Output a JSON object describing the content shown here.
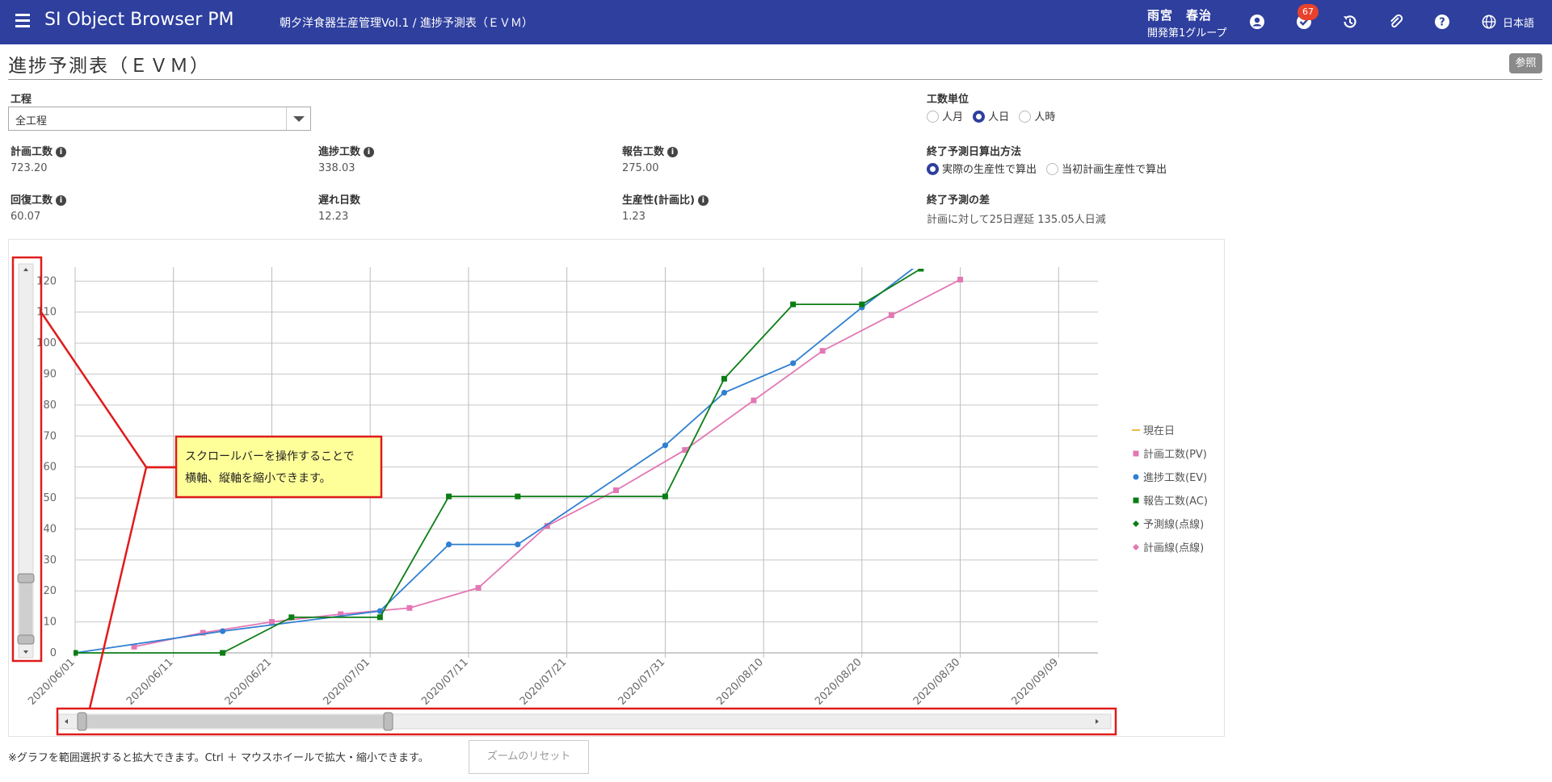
{
  "header": {
    "app_title": "SI Object Browser PM",
    "breadcrumb": "朝夕洋食器生産管理Vol.1 / 進捗予測表（ＥＶＭ）",
    "user_name": "雨宮　春治",
    "user_group": "開発第1グループ",
    "notification_count": "67",
    "language": "日本語",
    "icons": [
      "menu-icon",
      "account-icon",
      "task-check-icon",
      "history-icon",
      "attachment-icon",
      "help-icon",
      "globe-icon"
    ]
  },
  "page": {
    "title": "進捗予測表（ＥＶＭ）",
    "ref_button": "参照"
  },
  "form": {
    "process_label": "工程",
    "process_value": "全工程",
    "unit_label": "工数単位",
    "unit_options": [
      "人月",
      "人日",
      "人時"
    ],
    "unit_selected": "人日",
    "method_label": "終了予測日算出方法",
    "method_options": [
      "実際の生産性で算出",
      "当初計画生産性で算出"
    ],
    "method_selected": "実際の生産性で算出"
  },
  "stats": {
    "plan_label": "計画工数",
    "plan_value": "723.20",
    "progress_label": "進捗工数",
    "progress_value": "338.03",
    "report_label": "報告工数",
    "report_value": "275.00",
    "recovery_label": "回復工数",
    "recovery_value": "60.07",
    "delay_label": "遅れ日数",
    "delay_value": "12.23",
    "productivity_label": "生産性(計画比)",
    "productivity_value": "1.23",
    "diff_label": "終了予測の差",
    "diff_value": "計画に対して25日遅延 135.05人日減"
  },
  "chart_data": {
    "type": "line",
    "x_tick_labels": [
      "2020/06/01",
      "2020/06/11",
      "2020/06/21",
      "2020/07/01",
      "2020/07/11",
      "2020/07/21",
      "2020/07/31",
      "2020/08/10",
      "2020/08/20",
      "2020/08/30",
      "2020/09/09"
    ],
    "y_ticks": [
      0,
      10,
      20,
      30,
      40,
      50,
      60,
      70,
      80,
      90,
      100,
      110,
      120
    ],
    "xlim": [
      "2020-06-01",
      "2020-09-13"
    ],
    "ylim": [
      0,
      124
    ],
    "grid": true,
    "legend_position": "right",
    "series": [
      {
        "name": "現在日",
        "color": "#f4b942",
        "marker": "none",
        "points": []
      },
      {
        "name": "計画工数(PV)",
        "color": "#e377b4",
        "marker": "square",
        "points": [
          [
            "2020-06-07",
            2
          ],
          [
            "2020-06-14",
            6.5
          ],
          [
            "2020-06-21",
            10
          ],
          [
            "2020-06-28",
            12.5
          ],
          [
            "2020-07-05",
            14.5
          ],
          [
            "2020-07-12",
            21
          ],
          [
            "2020-07-19",
            41
          ],
          [
            "2020-07-26",
            52.5
          ],
          [
            "2020-08-02",
            65.5
          ],
          [
            "2020-08-09",
            81.5
          ],
          [
            "2020-08-16",
            97.5
          ],
          [
            "2020-08-23",
            109
          ],
          [
            "2020-08-30",
            120.5
          ]
        ]
      },
      {
        "name": "進捗工数(EV)",
        "color": "#2f7fd2",
        "marker": "circle",
        "points": [
          [
            "2020-06-01",
            0
          ],
          [
            "2020-06-16",
            7
          ],
          [
            "2020-07-02",
            13.5
          ],
          [
            "2020-07-09",
            35
          ],
          [
            "2020-07-16",
            35
          ],
          [
            "2020-07-31",
            67
          ],
          [
            "2020-08-06",
            84
          ],
          [
            "2020-08-13",
            93.5
          ],
          [
            "2020-08-20",
            111.5
          ],
          [
            "2020-08-26",
            126
          ]
        ]
      },
      {
        "name": "報告工数(AC)",
        "color": "#0b7d15",
        "marker": "square",
        "points": [
          [
            "2020-06-01",
            0
          ],
          [
            "2020-06-16",
            0
          ],
          [
            "2020-06-23",
            11.5
          ],
          [
            "2020-07-02",
            11.5
          ],
          [
            "2020-07-09",
            50.5
          ],
          [
            "2020-07-16",
            50.5
          ],
          [
            "2020-07-31",
            50.5
          ],
          [
            "2020-08-06",
            88.5
          ],
          [
            "2020-08-13",
            112.5
          ],
          [
            "2020-08-20",
            112.5
          ],
          [
            "2020-08-26",
            124
          ]
        ]
      },
      {
        "name": "予測線(点線)",
        "color": "#0b7d15",
        "marker": "diamond",
        "points": []
      },
      {
        "name": "計画線(点線)",
        "color": "#e377b4",
        "marker": "diamond",
        "points": []
      }
    ],
    "annotation": [
      "スクロールバーを操作することで",
      "横軸、縦軸を縮小できます。"
    ]
  },
  "footer": {
    "note": "※グラフを範囲選択すると拡大できます。Ctrl ＋ マウスホイールで拡大・縮小できます。",
    "reset_button": "ズームのリセット"
  }
}
